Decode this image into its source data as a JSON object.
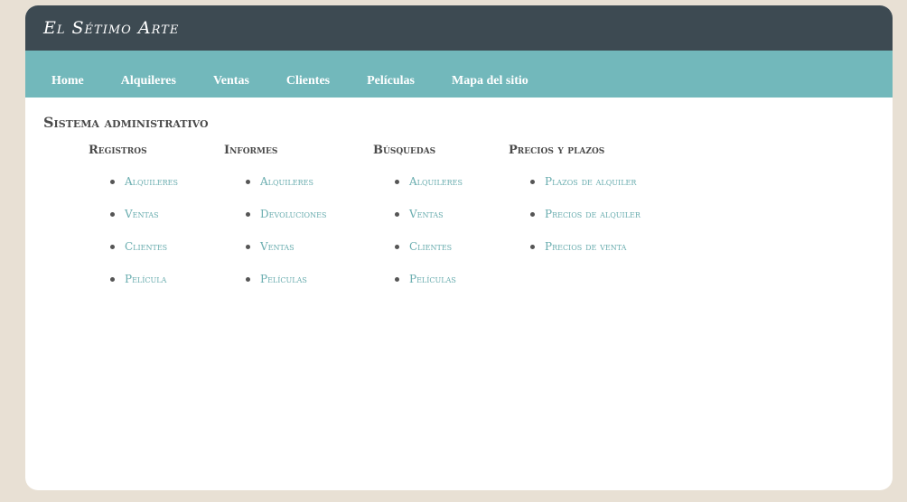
{
  "header": {
    "site_title": "El Sétimo Arte"
  },
  "nav": {
    "items": [
      {
        "label": "Home"
      },
      {
        "label": "Alquileres"
      },
      {
        "label": "Ventas"
      },
      {
        "label": "Clientes"
      },
      {
        "label": "Películas"
      },
      {
        "label": "Mapa del sitio"
      }
    ]
  },
  "main": {
    "title": "Sistema administrativo",
    "columns": [
      {
        "title": "Registros",
        "links": [
          "Alquileres",
          "Ventas",
          "Clientes",
          "Película"
        ]
      },
      {
        "title": "Informes",
        "links": [
          "Alquileres",
          "Devoluciones",
          "Ventas",
          "Películas"
        ]
      },
      {
        "title": "Búsquedas",
        "links": [
          "Alquileres",
          "Ventas",
          "Clientes",
          "Películas"
        ]
      },
      {
        "title": "Precios y plazos",
        "links": [
          "Plazos de alquiler",
          "Precios de alquiler",
          "Precios de venta"
        ]
      }
    ]
  },
  "colors": {
    "background": "#e8e0d4",
    "header": "#3d4a52",
    "navbar": "#72b8bb",
    "link": "#6aadaf"
  }
}
